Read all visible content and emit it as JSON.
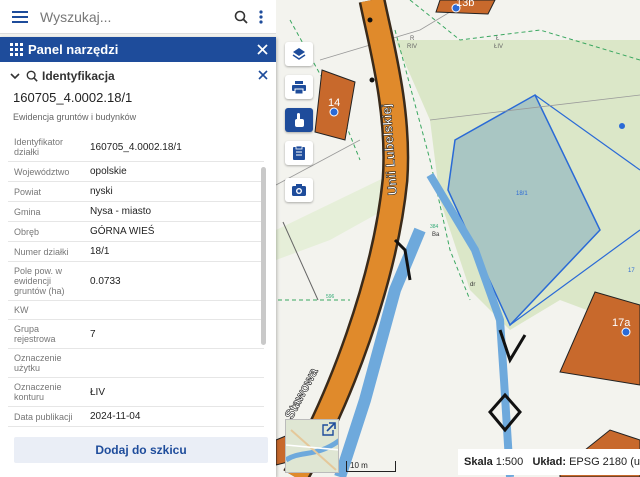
{
  "search": {
    "placeholder": "Wyszukaj..."
  },
  "panel": {
    "title": "Panel narzędzi",
    "section_title": "Identyfikacja",
    "parcel_id": "160705_4.0002.18/1",
    "layer_name": "Ewidencja gruntów i budynków",
    "attributes": [
      {
        "key": "Identyfikator działki",
        "value": "160705_4.0002.18/1"
      },
      {
        "key": "Województwo",
        "value": "opolskie"
      },
      {
        "key": "Powiat",
        "value": "nyski"
      },
      {
        "key": "Gmina",
        "value": "Nysa - miasto"
      },
      {
        "key": "Obręb",
        "value": "GÓRNA WIEŚ"
      },
      {
        "key": "Numer działki",
        "value": "18/1"
      },
      {
        "key": "Pole pow. w ewidencji gruntów (ha)",
        "value": "0.0733"
      },
      {
        "key": "KW",
        "value": ""
      },
      {
        "key": "Grupa rejestrowa",
        "value": "7"
      },
      {
        "key": "Oznaczenie użytku",
        "value": ""
      },
      {
        "key": "Oznaczenie konturu",
        "value": "ŁIV"
      },
      {
        "key": "Data publikacji",
        "value": "2024-11-04"
      }
    ],
    "add_button": "Dodaj do szkicu"
  },
  "map": {
    "street_main": "Unii Lubelskiej",
    "street_bottom": "Stawowa",
    "building_14": "14",
    "building_13b": "13b",
    "building_17a": "17a",
    "label_r": "R",
    "label_riv": "RIV",
    "label_l": "Ł",
    "label_liv": "ŁIV",
    "label_ba": "Ba",
    "label_dr": "dr",
    "label_384": "384",
    "label_596": "596",
    "label_18_1": "18/1",
    "label_17": "17"
  },
  "scale": {
    "label": "Skala",
    "value": "1:500",
    "bar_text": "10 m",
    "crs_label": "Układ:",
    "crs_value": "EPSG 2180 (u"
  },
  "colors": {
    "header_blue": "#1e4c9b",
    "road_orange": "#e08a2b",
    "building_brown": "#c8692c",
    "water_blue": "#6ea9dc",
    "field_green": "#dbe7c8",
    "parcel_teal": "#a9c6c3"
  }
}
